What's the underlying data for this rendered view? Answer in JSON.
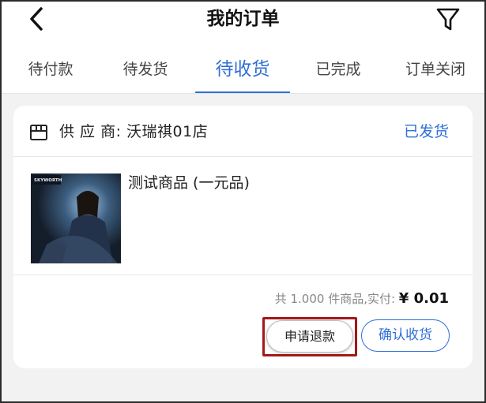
{
  "header": {
    "title": "我的订单",
    "back_icon": "chevron-left-icon",
    "filter_icon": "filter-icon"
  },
  "tabs": [
    {
      "label": "待付款",
      "active": false
    },
    {
      "label": "待发货",
      "active": false
    },
    {
      "label": "待收货",
      "active": true
    },
    {
      "label": "已完成",
      "active": false
    },
    {
      "label": "订单关闭",
      "active": false
    }
  ],
  "order": {
    "store_icon": "store-icon",
    "supplier_label": "供 应 商: 沃瑞祺01店",
    "status": "已发货",
    "product": {
      "name": "测试商品 (一元品)",
      "thumb_brand": "SKYWORTH"
    },
    "summary_text": "共 1.000 件商品,实付: ",
    "price": "¥ 0.01",
    "actions": {
      "refund": "申请退款",
      "confirm": "确认收货"
    }
  },
  "colors": {
    "accent": "#2f6fd6",
    "highlight_box": "#a4171c",
    "background": "#f2f2f2"
  }
}
